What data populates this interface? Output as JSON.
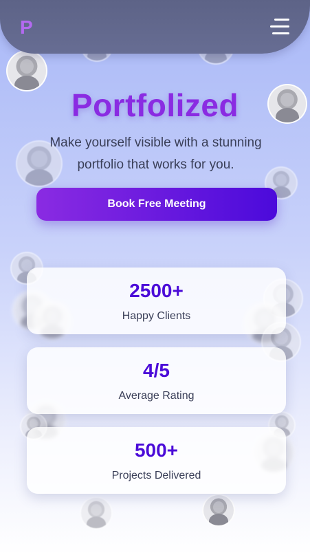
{
  "header": {
    "logo": "P",
    "menu_icon": "hamburger-menu-icon"
  },
  "hero": {
    "title": "Portfolized",
    "subtitle": "Make yourself visible with a stunning portfolio that works for you.",
    "cta_label": "Book Free Meeting"
  },
  "stats": [
    {
      "value": "2500+",
      "label": "Happy Clients"
    },
    {
      "value": "4/5",
      "label": "Average Rating"
    },
    {
      "value": "500+",
      "label": "Projects Delivered"
    }
  ],
  "colors": {
    "brand_purple": "#8a2be2",
    "accent_indigo": "#4b0bd8",
    "header_bg": "#5d6387",
    "logo": "#b36af0"
  }
}
